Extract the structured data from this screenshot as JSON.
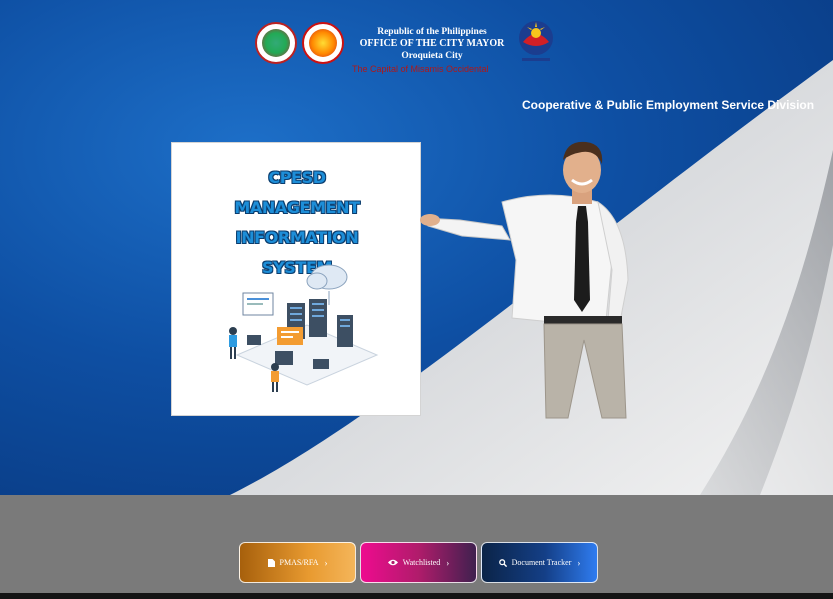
{
  "header": {
    "line1": "Republic of the Philippines",
    "line2": "OFFICE OF THE CITY MAYOR",
    "line3": "Oroquieta City",
    "tagline": "The Capital of Misamis Occidental",
    "division": "Cooperative & Public Employment Service Division",
    "logos": [
      "city-seal-icon",
      "peso-seal-icon",
      "bagong-pilipinas-logo"
    ]
  },
  "card": {
    "title_lines": [
      "CPESD",
      "MANAGEMENT INFORMATION",
      "SYSTEM"
    ],
    "illustration": "data-center-illustration"
  },
  "buttons": [
    {
      "label": "PMAS/RFA",
      "icon": "document-icon"
    },
    {
      "label": "Watchlisted",
      "icon": "eye-icon"
    },
    {
      "label": "Document Tracker",
      "icon": "search-icon"
    }
  ],
  "colors": {
    "hero_blue": "#0e4fa3",
    "title_blue": "#1d8ed8",
    "tagline_red": "#b01818",
    "btn_pmas": "#e89a30",
    "btn_watch": "#ee0b8f",
    "btn_doc": "#2f7cf0"
  }
}
